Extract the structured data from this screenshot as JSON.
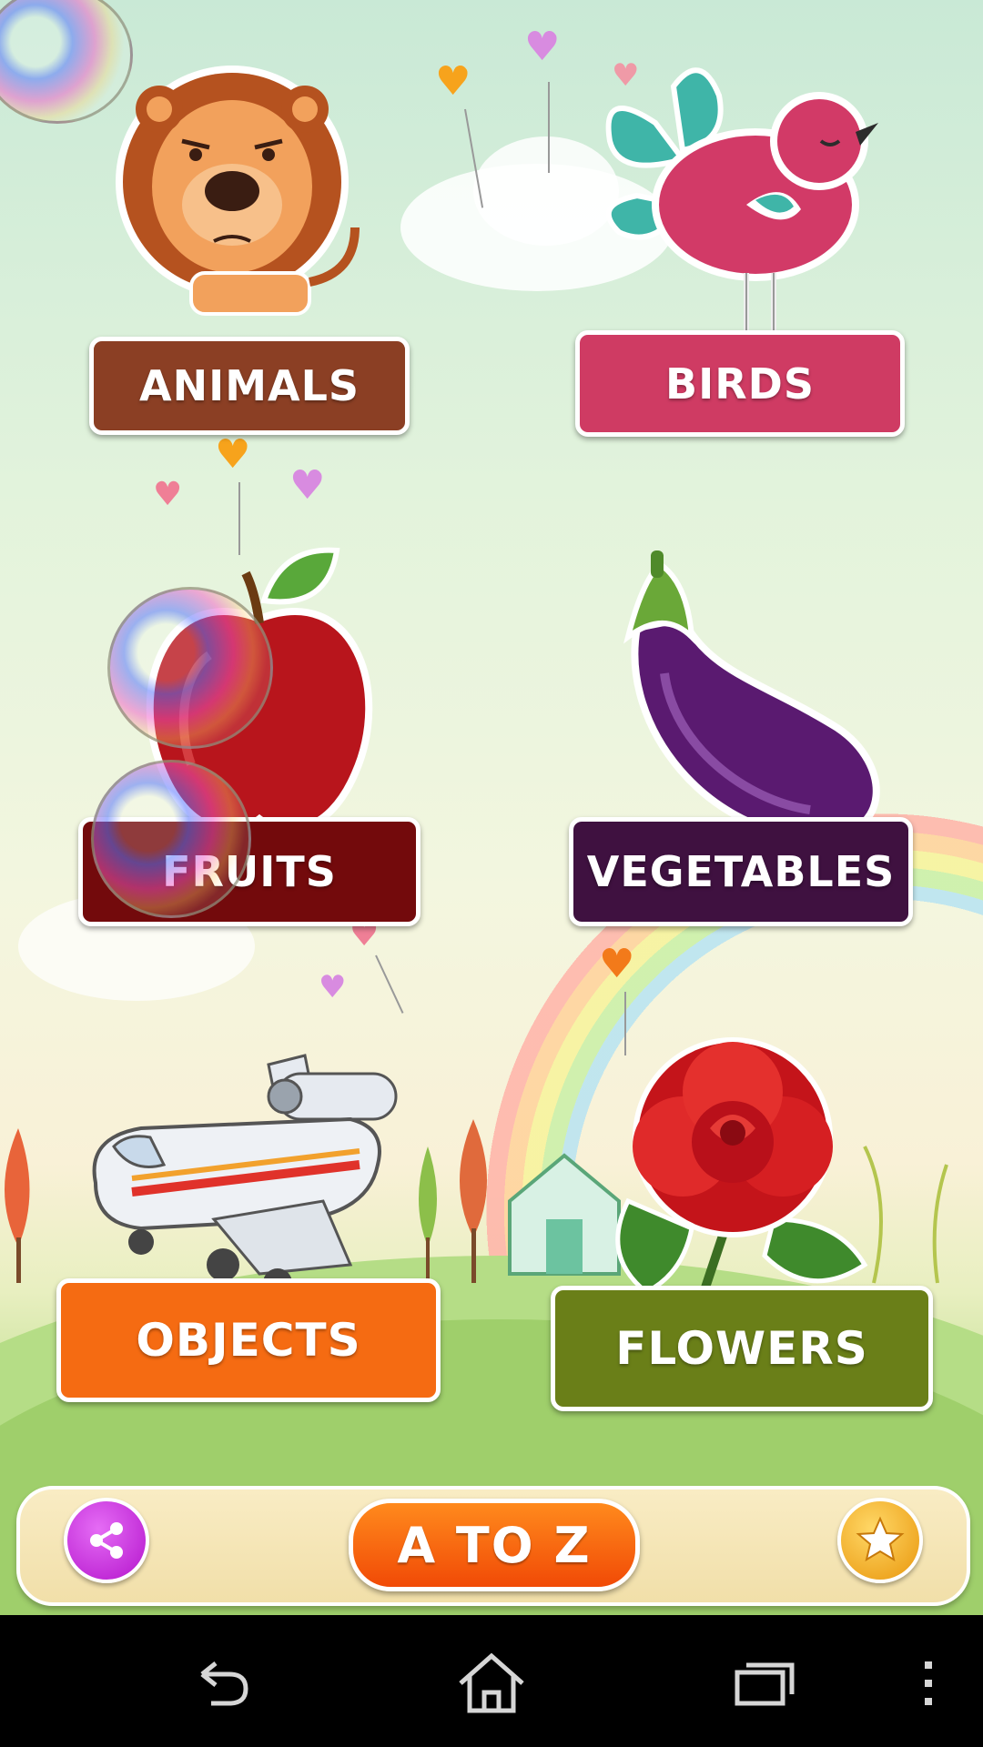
{
  "categories": [
    {
      "id": "animals",
      "label": "ANIMALS",
      "color": "#8b3f24"
    },
    {
      "id": "birds",
      "label": "BIRDS",
      "color": "#cf3b63"
    },
    {
      "id": "fruits",
      "label": "FRUITS",
      "color": "#730a0c"
    },
    {
      "id": "vegetables",
      "label": "VEGETABLES",
      "color": "#3f1140"
    },
    {
      "id": "objects",
      "label": "OBJECTS",
      "color": "#f56b12"
    },
    {
      "id": "flowers",
      "label": "FLOWERS",
      "color": "#6a7f18"
    }
  ],
  "bottom_bar": {
    "atoz_label": "A TO Z",
    "share_icon": "share-icon",
    "rate_icon": "star-icon",
    "share_color": "#c21fd8",
    "rate_color": "#f2a91a"
  },
  "navbar": {
    "icons": [
      "back-icon",
      "home-icon",
      "recent-apps-icon",
      "overflow-menu-icon"
    ]
  }
}
